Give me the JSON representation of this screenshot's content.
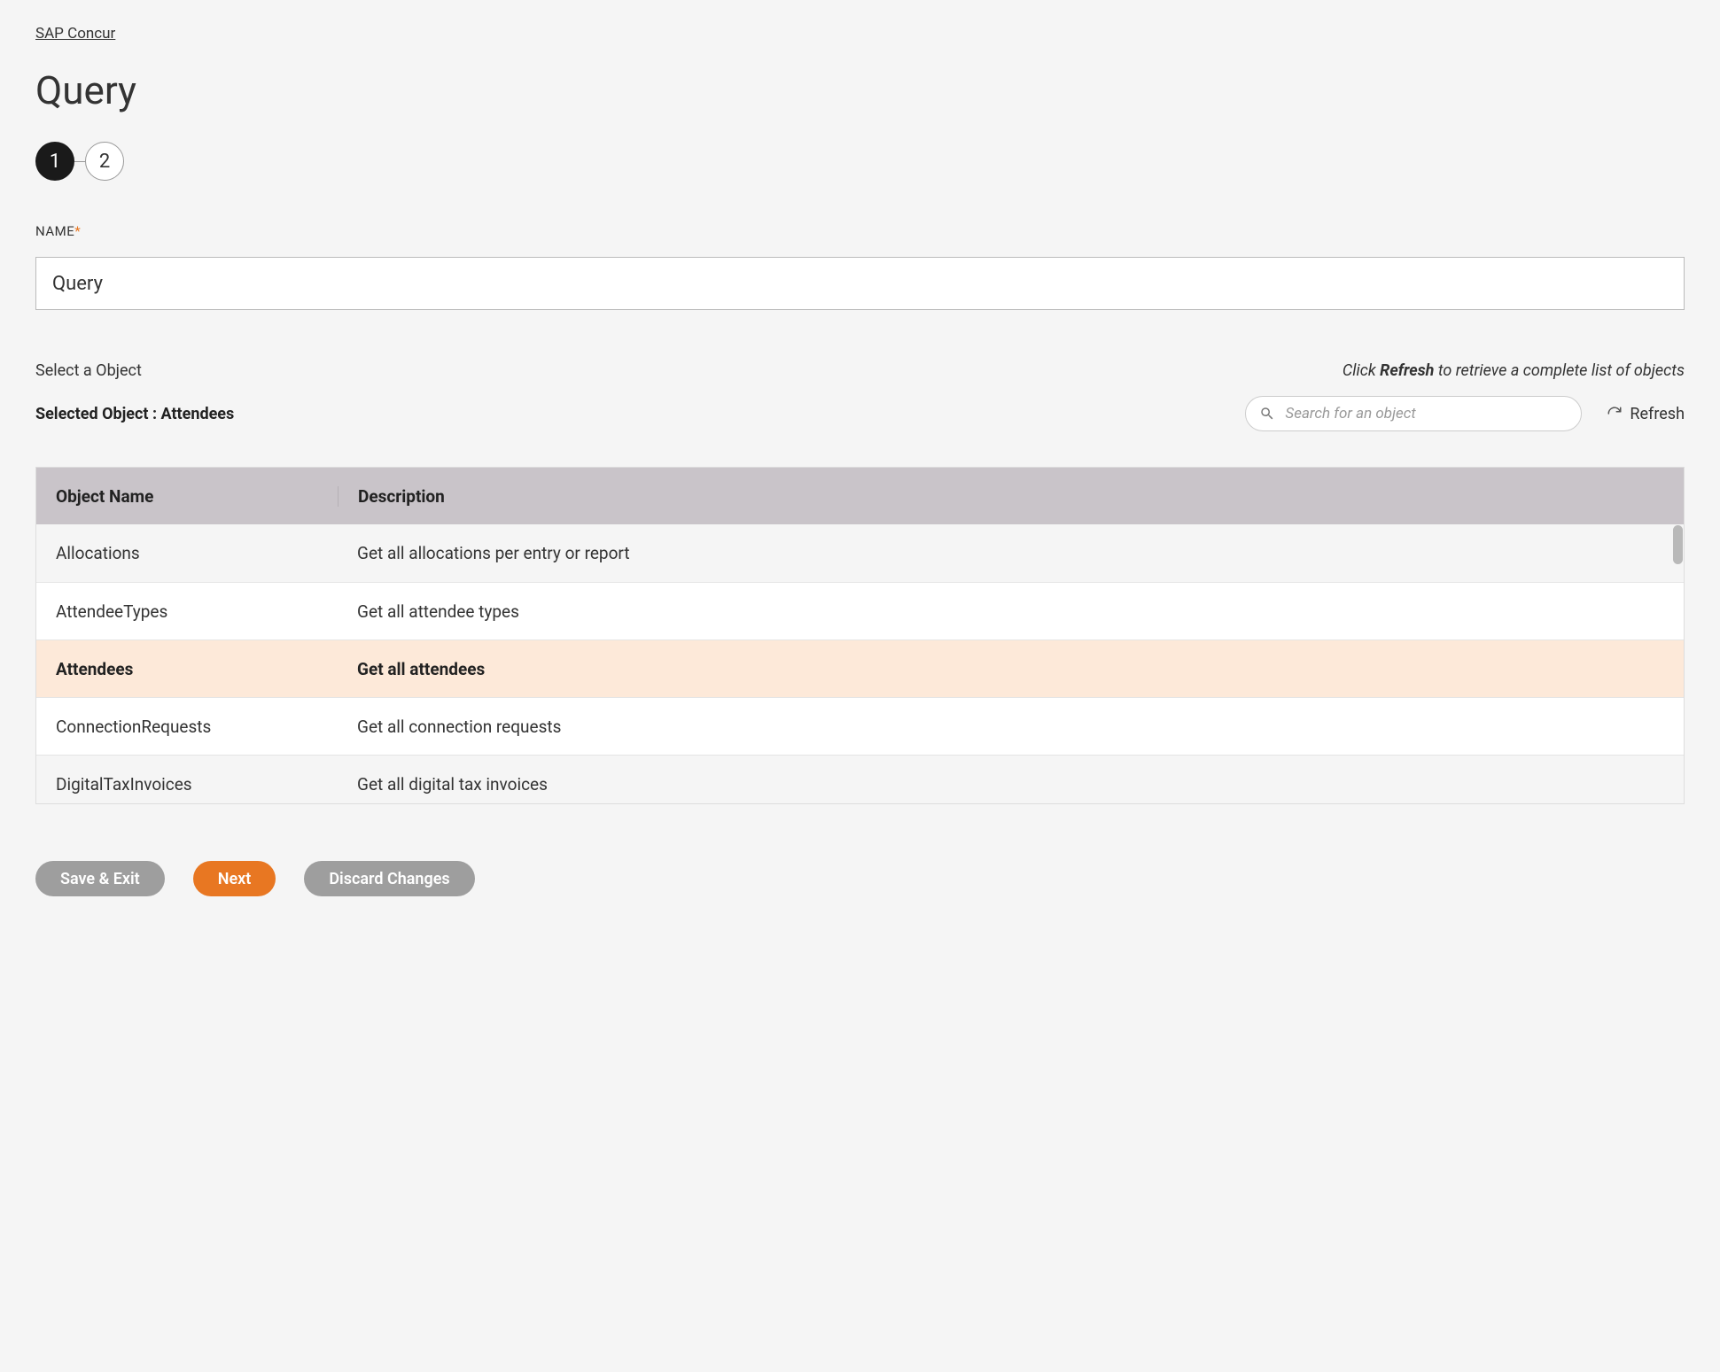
{
  "breadcrumb": {
    "label": "SAP Concur"
  },
  "page": {
    "title": "Query"
  },
  "steps": {
    "step1": "1",
    "step2": "2"
  },
  "form": {
    "name_label": "NAME",
    "required_marker": "*",
    "name_value": "Query"
  },
  "objectSection": {
    "select_label": "Select a Object",
    "hint_prefix": "Click ",
    "hint_bold": "Refresh",
    "hint_suffix": " to retrieve a complete list of objects",
    "selected_prefix": "Selected Object : ",
    "selected_value": "Attendees",
    "search_placeholder": "Search for an object",
    "refresh_label": "Refresh"
  },
  "table": {
    "header_name": "Object Name",
    "header_desc": "Description",
    "rows": [
      {
        "name": "Allocations",
        "desc": "Get all allocations per entry or report",
        "selected": false,
        "alt": true
      },
      {
        "name": "AttendeeTypes",
        "desc": "Get all attendee types",
        "selected": false,
        "alt": false
      },
      {
        "name": "Attendees",
        "desc": "Get all attendees",
        "selected": true,
        "alt": false
      },
      {
        "name": "ConnectionRequests",
        "desc": "Get all connection requests",
        "selected": false,
        "alt": false
      },
      {
        "name": "DigitalTaxInvoices",
        "desc": "Get all digital tax invoices",
        "selected": false,
        "alt": true
      }
    ]
  },
  "actions": {
    "save_exit": "Save & Exit",
    "next": "Next",
    "discard": "Discard Changes"
  }
}
